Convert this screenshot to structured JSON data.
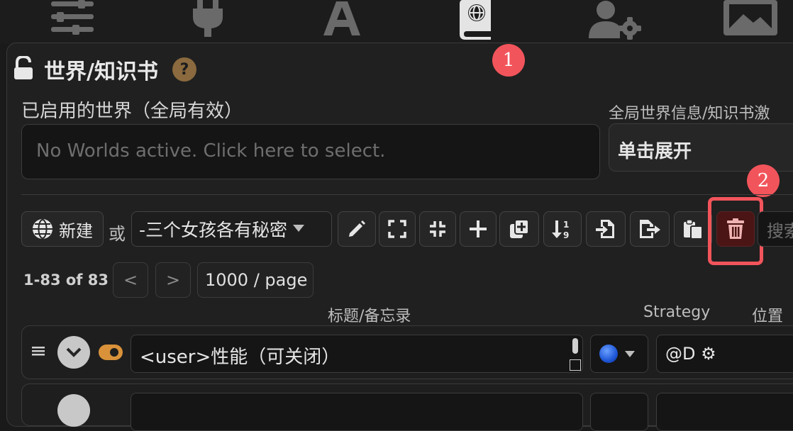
{
  "top_nav": {
    "icons": [
      "sliders-icon",
      "plug-icon",
      "font-icon",
      "book-globe-icon",
      "user-gear-icon",
      "image-icon"
    ]
  },
  "annotations": {
    "marker_1": "1",
    "marker_2": "2"
  },
  "header": {
    "title": "世界/知识书",
    "help": "?"
  },
  "active_worlds": {
    "label": "已启用的世界（全局有效）",
    "placeholder": "No Worlds active. Click here to select."
  },
  "global_settings": {
    "label": "全局世界信息/知识书激",
    "expand_label": "单击展开"
  },
  "toolbar": {
    "new_label": "新建",
    "or_label": "或",
    "selected_book": "-三个女孩各有秘密",
    "search_placeholder": "搜索"
  },
  "pagination": {
    "range": "1-83 of 83",
    "prev": "<",
    "next": ">",
    "page_size": "1000 / page"
  },
  "columns": {
    "title": "标题/备忘录",
    "strategy": "Strategy",
    "position": "位置"
  },
  "entries": [
    {
      "title": "<user>性能（可关闭）",
      "strategy_icon": "blue-circle",
      "position": "@D ⚙"
    }
  ],
  "colors": {
    "accent_red": "#f2545b",
    "toggle_orange": "#d9923a",
    "strategy_blue": "#1e56d6"
  }
}
